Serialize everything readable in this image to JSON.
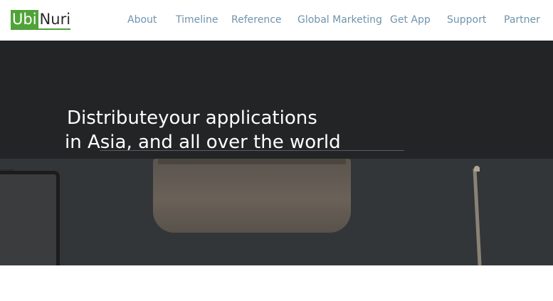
{
  "logo": {
    "part1": "Ubi",
    "part2": "Nuri"
  },
  "nav": {
    "items": [
      {
        "label": "About"
      },
      {
        "label": "Timeline"
      },
      {
        "label": "Reference"
      },
      {
        "label": "Global Marketing"
      },
      {
        "label": "Get App"
      },
      {
        "label": "Support"
      },
      {
        "label": "Partner"
      }
    ]
  },
  "hero": {
    "line1": "Distributeyour applications",
    "line2": "in Asia, and all over the world"
  },
  "colors": {
    "brand_green": "#4fa338",
    "nav_text": "#6f93ad",
    "hero_dark": "#222426"
  }
}
